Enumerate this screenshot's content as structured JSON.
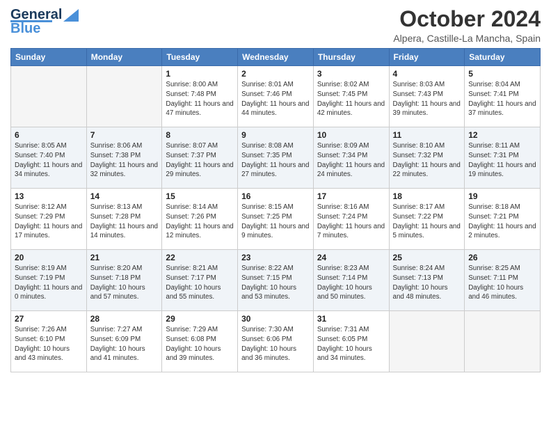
{
  "logo": {
    "line1": "General",
    "line2": "Blue"
  },
  "title": "October 2024",
  "location": "Alpera, Castille-La Mancha, Spain",
  "days_of_week": [
    "Sunday",
    "Monday",
    "Tuesday",
    "Wednesday",
    "Thursday",
    "Friday",
    "Saturday"
  ],
  "weeks": [
    [
      {
        "day": "",
        "info": ""
      },
      {
        "day": "",
        "info": ""
      },
      {
        "day": "1",
        "info": "Sunrise: 8:00 AM\nSunset: 7:48 PM\nDaylight: 11 hours and 47 minutes."
      },
      {
        "day": "2",
        "info": "Sunrise: 8:01 AM\nSunset: 7:46 PM\nDaylight: 11 hours and 44 minutes."
      },
      {
        "day": "3",
        "info": "Sunrise: 8:02 AM\nSunset: 7:45 PM\nDaylight: 11 hours and 42 minutes."
      },
      {
        "day": "4",
        "info": "Sunrise: 8:03 AM\nSunset: 7:43 PM\nDaylight: 11 hours and 39 minutes."
      },
      {
        "day": "5",
        "info": "Sunrise: 8:04 AM\nSunset: 7:41 PM\nDaylight: 11 hours and 37 minutes."
      }
    ],
    [
      {
        "day": "6",
        "info": "Sunrise: 8:05 AM\nSunset: 7:40 PM\nDaylight: 11 hours and 34 minutes."
      },
      {
        "day": "7",
        "info": "Sunrise: 8:06 AM\nSunset: 7:38 PM\nDaylight: 11 hours and 32 minutes."
      },
      {
        "day": "8",
        "info": "Sunrise: 8:07 AM\nSunset: 7:37 PM\nDaylight: 11 hours and 29 minutes."
      },
      {
        "day": "9",
        "info": "Sunrise: 8:08 AM\nSunset: 7:35 PM\nDaylight: 11 hours and 27 minutes."
      },
      {
        "day": "10",
        "info": "Sunrise: 8:09 AM\nSunset: 7:34 PM\nDaylight: 11 hours and 24 minutes."
      },
      {
        "day": "11",
        "info": "Sunrise: 8:10 AM\nSunset: 7:32 PM\nDaylight: 11 hours and 22 minutes."
      },
      {
        "day": "12",
        "info": "Sunrise: 8:11 AM\nSunset: 7:31 PM\nDaylight: 11 hours and 19 minutes."
      }
    ],
    [
      {
        "day": "13",
        "info": "Sunrise: 8:12 AM\nSunset: 7:29 PM\nDaylight: 11 hours and 17 minutes."
      },
      {
        "day": "14",
        "info": "Sunrise: 8:13 AM\nSunset: 7:28 PM\nDaylight: 11 hours and 14 minutes."
      },
      {
        "day": "15",
        "info": "Sunrise: 8:14 AM\nSunset: 7:26 PM\nDaylight: 11 hours and 12 minutes."
      },
      {
        "day": "16",
        "info": "Sunrise: 8:15 AM\nSunset: 7:25 PM\nDaylight: 11 hours and 9 minutes."
      },
      {
        "day": "17",
        "info": "Sunrise: 8:16 AM\nSunset: 7:24 PM\nDaylight: 11 hours and 7 minutes."
      },
      {
        "day": "18",
        "info": "Sunrise: 8:17 AM\nSunset: 7:22 PM\nDaylight: 11 hours and 5 minutes."
      },
      {
        "day": "19",
        "info": "Sunrise: 8:18 AM\nSunset: 7:21 PM\nDaylight: 11 hours and 2 minutes."
      }
    ],
    [
      {
        "day": "20",
        "info": "Sunrise: 8:19 AM\nSunset: 7:19 PM\nDaylight: 11 hours and 0 minutes."
      },
      {
        "day": "21",
        "info": "Sunrise: 8:20 AM\nSunset: 7:18 PM\nDaylight: 10 hours and 57 minutes."
      },
      {
        "day": "22",
        "info": "Sunrise: 8:21 AM\nSunset: 7:17 PM\nDaylight: 10 hours and 55 minutes."
      },
      {
        "day": "23",
        "info": "Sunrise: 8:22 AM\nSunset: 7:15 PM\nDaylight: 10 hours and 53 minutes."
      },
      {
        "day": "24",
        "info": "Sunrise: 8:23 AM\nSunset: 7:14 PM\nDaylight: 10 hours and 50 minutes."
      },
      {
        "day": "25",
        "info": "Sunrise: 8:24 AM\nSunset: 7:13 PM\nDaylight: 10 hours and 48 minutes."
      },
      {
        "day": "26",
        "info": "Sunrise: 8:25 AM\nSunset: 7:11 PM\nDaylight: 10 hours and 46 minutes."
      }
    ],
    [
      {
        "day": "27",
        "info": "Sunrise: 7:26 AM\nSunset: 6:10 PM\nDaylight: 10 hours and 43 minutes."
      },
      {
        "day": "28",
        "info": "Sunrise: 7:27 AM\nSunset: 6:09 PM\nDaylight: 10 hours and 41 minutes."
      },
      {
        "day": "29",
        "info": "Sunrise: 7:29 AM\nSunset: 6:08 PM\nDaylight: 10 hours and 39 minutes."
      },
      {
        "day": "30",
        "info": "Sunrise: 7:30 AM\nSunset: 6:06 PM\nDaylight: 10 hours and 36 minutes."
      },
      {
        "day": "31",
        "info": "Sunrise: 7:31 AM\nSunset: 6:05 PM\nDaylight: 10 hours and 34 minutes."
      },
      {
        "day": "",
        "info": ""
      },
      {
        "day": "",
        "info": ""
      }
    ]
  ]
}
